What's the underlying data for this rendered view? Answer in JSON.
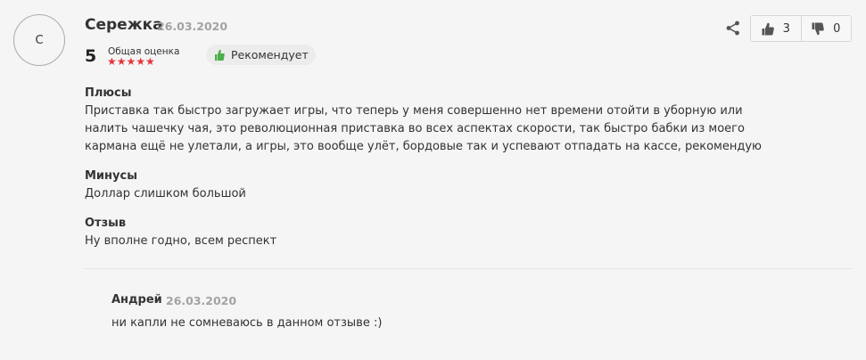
{
  "review": {
    "author_initial": "С",
    "author_name": "Сережка",
    "date": "26.03.2020",
    "rating": "5",
    "rating_label": "Общая оценка",
    "stars": "★★★★★",
    "stars_count": 5,
    "recommend_label": "Рекомендует",
    "likes": "3",
    "dislikes": "0",
    "pros_title": "Плюсы",
    "pros_text": "Приставка так быстро загружает игры, что теперь у меня совершенно нет времени отойти в уборную или налить чашечку чая, это революционная приставка во всех аспектах скорости, так быстро бабки из моего кармана ещё не улетали, а игры, это вообще улёт, бордовые так и успевают отпадать на кассе, рекомендую",
    "cons_title": "Минусы",
    "cons_text": "Доллар слишком большой",
    "review_title": "Отзыв",
    "review_text": "Ну вполне годно, всем респект"
  },
  "reply": {
    "author_name": "Андрей",
    "date": "26.03.2020",
    "text": "ни капли не сомневаюсь в данном отзыве :)"
  },
  "colors": {
    "star": "#e8333b",
    "recommend_icon": "#4cae4c",
    "muted": "#a3a3a3"
  },
  "icons": {
    "share": "share-icon",
    "like": "thumbs-up-icon",
    "dislike": "thumbs-down-icon",
    "recommend": "thumbs-up-green-icon"
  }
}
